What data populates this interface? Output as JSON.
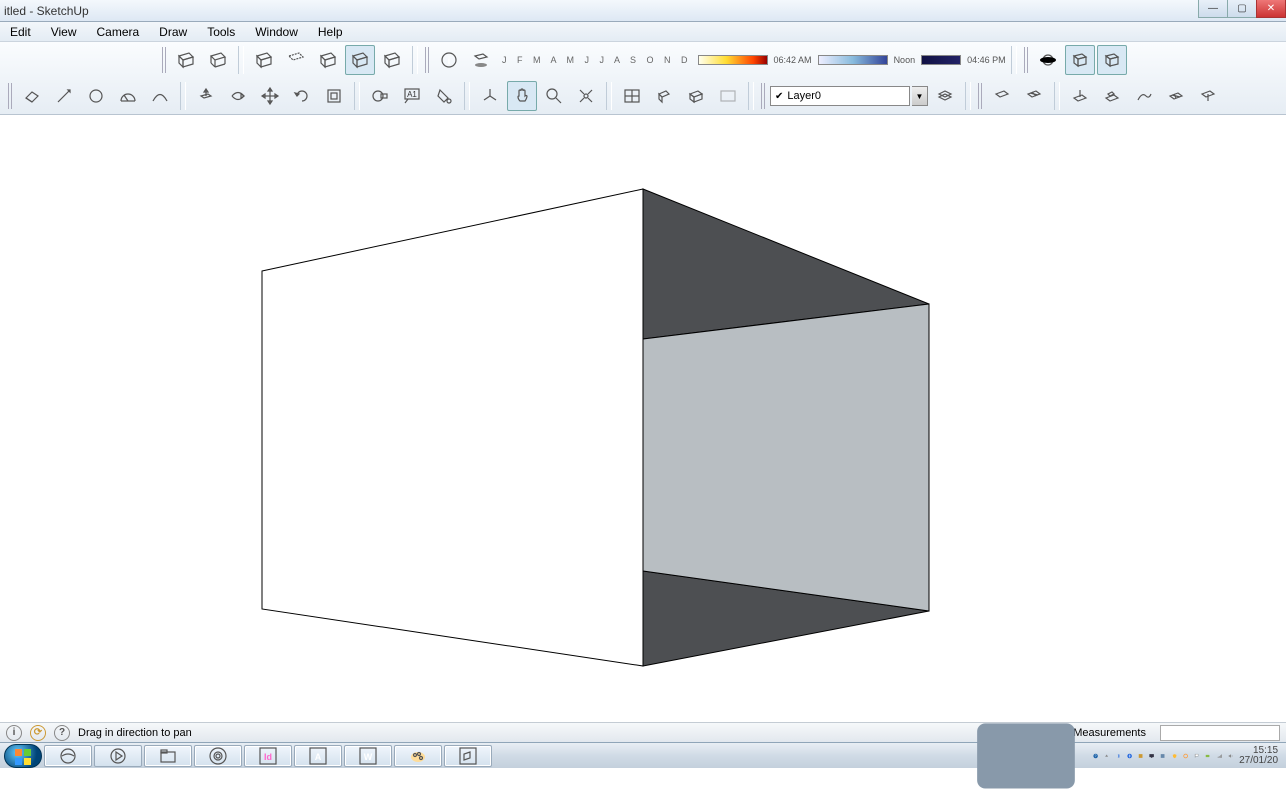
{
  "window": {
    "title": "itled - SketchUp"
  },
  "menu": [
    "Edit",
    "View",
    "Camera",
    "Draw",
    "Tools",
    "Window",
    "Help"
  ],
  "months": "J F M A M J J A S O N D",
  "time": {
    "sunrise": "06:42 AM",
    "noon": "Noon",
    "sunset": "04:46 PM"
  },
  "layer": {
    "name": "Layer0"
  },
  "status": {
    "hint": "Drag in direction to pan",
    "measurements_label": "Measurements"
  },
  "clock": {
    "time": "15:15",
    "date": "27/01/20"
  }
}
